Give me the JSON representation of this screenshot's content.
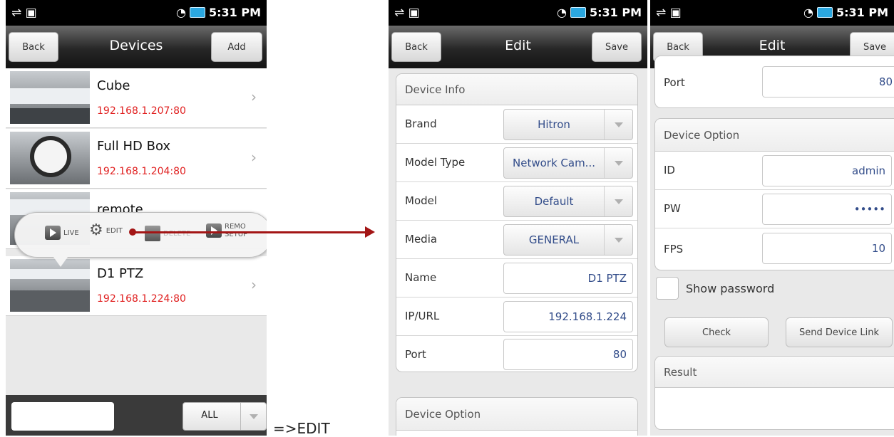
{
  "status": {
    "time": "5:31 PM"
  },
  "screen1": {
    "back": "Back",
    "title": "Devices",
    "add": "Add",
    "devices": [
      {
        "name": "Cube",
        "ip": "192.168.1.207:80"
      },
      {
        "name": "Full HD Box",
        "ip": "192.168.1.204:80"
      },
      {
        "name": "remote",
        "ip": ""
      },
      {
        "name": "D1 PTZ",
        "ip": "192.168.1.224:80"
      }
    ],
    "popup": {
      "live": "LIVE",
      "edit": "EDIT",
      "delete": "DELETE",
      "remote": "REMO",
      "setup": "SETUP"
    },
    "filter_value": "ALL"
  },
  "edit_note": "=>EDIT",
  "screen2": {
    "back": "Back",
    "title": "Edit",
    "save": "Save",
    "device_info": "Device Info",
    "brand_label": "Brand",
    "brand_value": "Hitron",
    "model_type_label": "Model Type",
    "model_type_value": "Network Cam...",
    "model_label": "Model",
    "model_value": "Default",
    "media_label": "Media",
    "media_value": "GENERAL",
    "name_label": "Name",
    "name_value": "D1 PTZ",
    "ip_label": "IP/URL",
    "ip_value": "192.168.1.224",
    "port_label": "Port",
    "port_value": "80",
    "device_option": "Device Option"
  },
  "screen3": {
    "back": "Back",
    "title": "Edit",
    "save": "Save",
    "port_label": "Port",
    "port_value": "80",
    "device_option": "Device Option",
    "id_label": "ID",
    "id_value": "admin",
    "pw_label": "PW",
    "pw_value": "•••••",
    "fps_label": "FPS",
    "fps_value": "10",
    "show_password": "Show password",
    "check": "Check",
    "send_link": "Send Device Link",
    "result": "Result"
  }
}
